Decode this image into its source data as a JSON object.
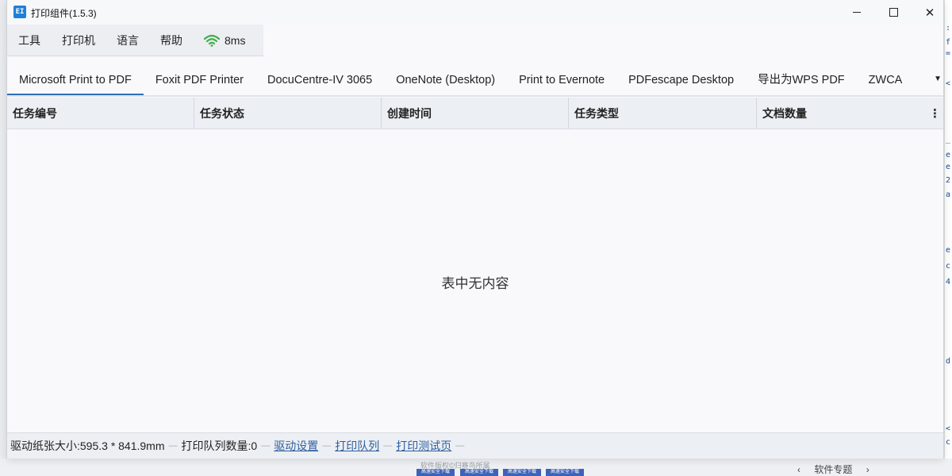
{
  "window": {
    "title": "打印组件(1.5.3)",
    "app_icon": "EI"
  },
  "menubar": {
    "items": [
      "工具",
      "打印机",
      "语言",
      "帮助"
    ],
    "latency": "8ms",
    "latency_icon": "wifi-icon",
    "latency_color": "#3fae49"
  },
  "tabs": [
    {
      "label": "Microsoft Print to PDF"
    },
    {
      "label": "Foxit PDF Printer"
    },
    {
      "label": "DocuCentre-IV 3065"
    },
    {
      "label": "OneNote (Desktop)"
    },
    {
      "label": "Print to Evernote"
    },
    {
      "label": "PDFescape Desktop"
    },
    {
      "label": "导出为WPS PDF"
    },
    {
      "label": "ZWCA"
    }
  ],
  "table": {
    "columns": [
      "任务编号",
      "任务状态",
      "创建时间",
      "任务类型",
      "文档数量"
    ],
    "empty_text": "表中无内容"
  },
  "status": {
    "paper_size": "驱动纸张大小:595.3 * 841.9mm",
    "queue_count": "打印队列数量:0",
    "driver_settings": "驱动设置",
    "print_queue": "打印队列",
    "test_page": "打印测试页"
  },
  "background": {
    "copyright": "软件版权©归赛鸟所属",
    "download_label": "高速安全下载",
    "nav_label": "软件专题"
  }
}
